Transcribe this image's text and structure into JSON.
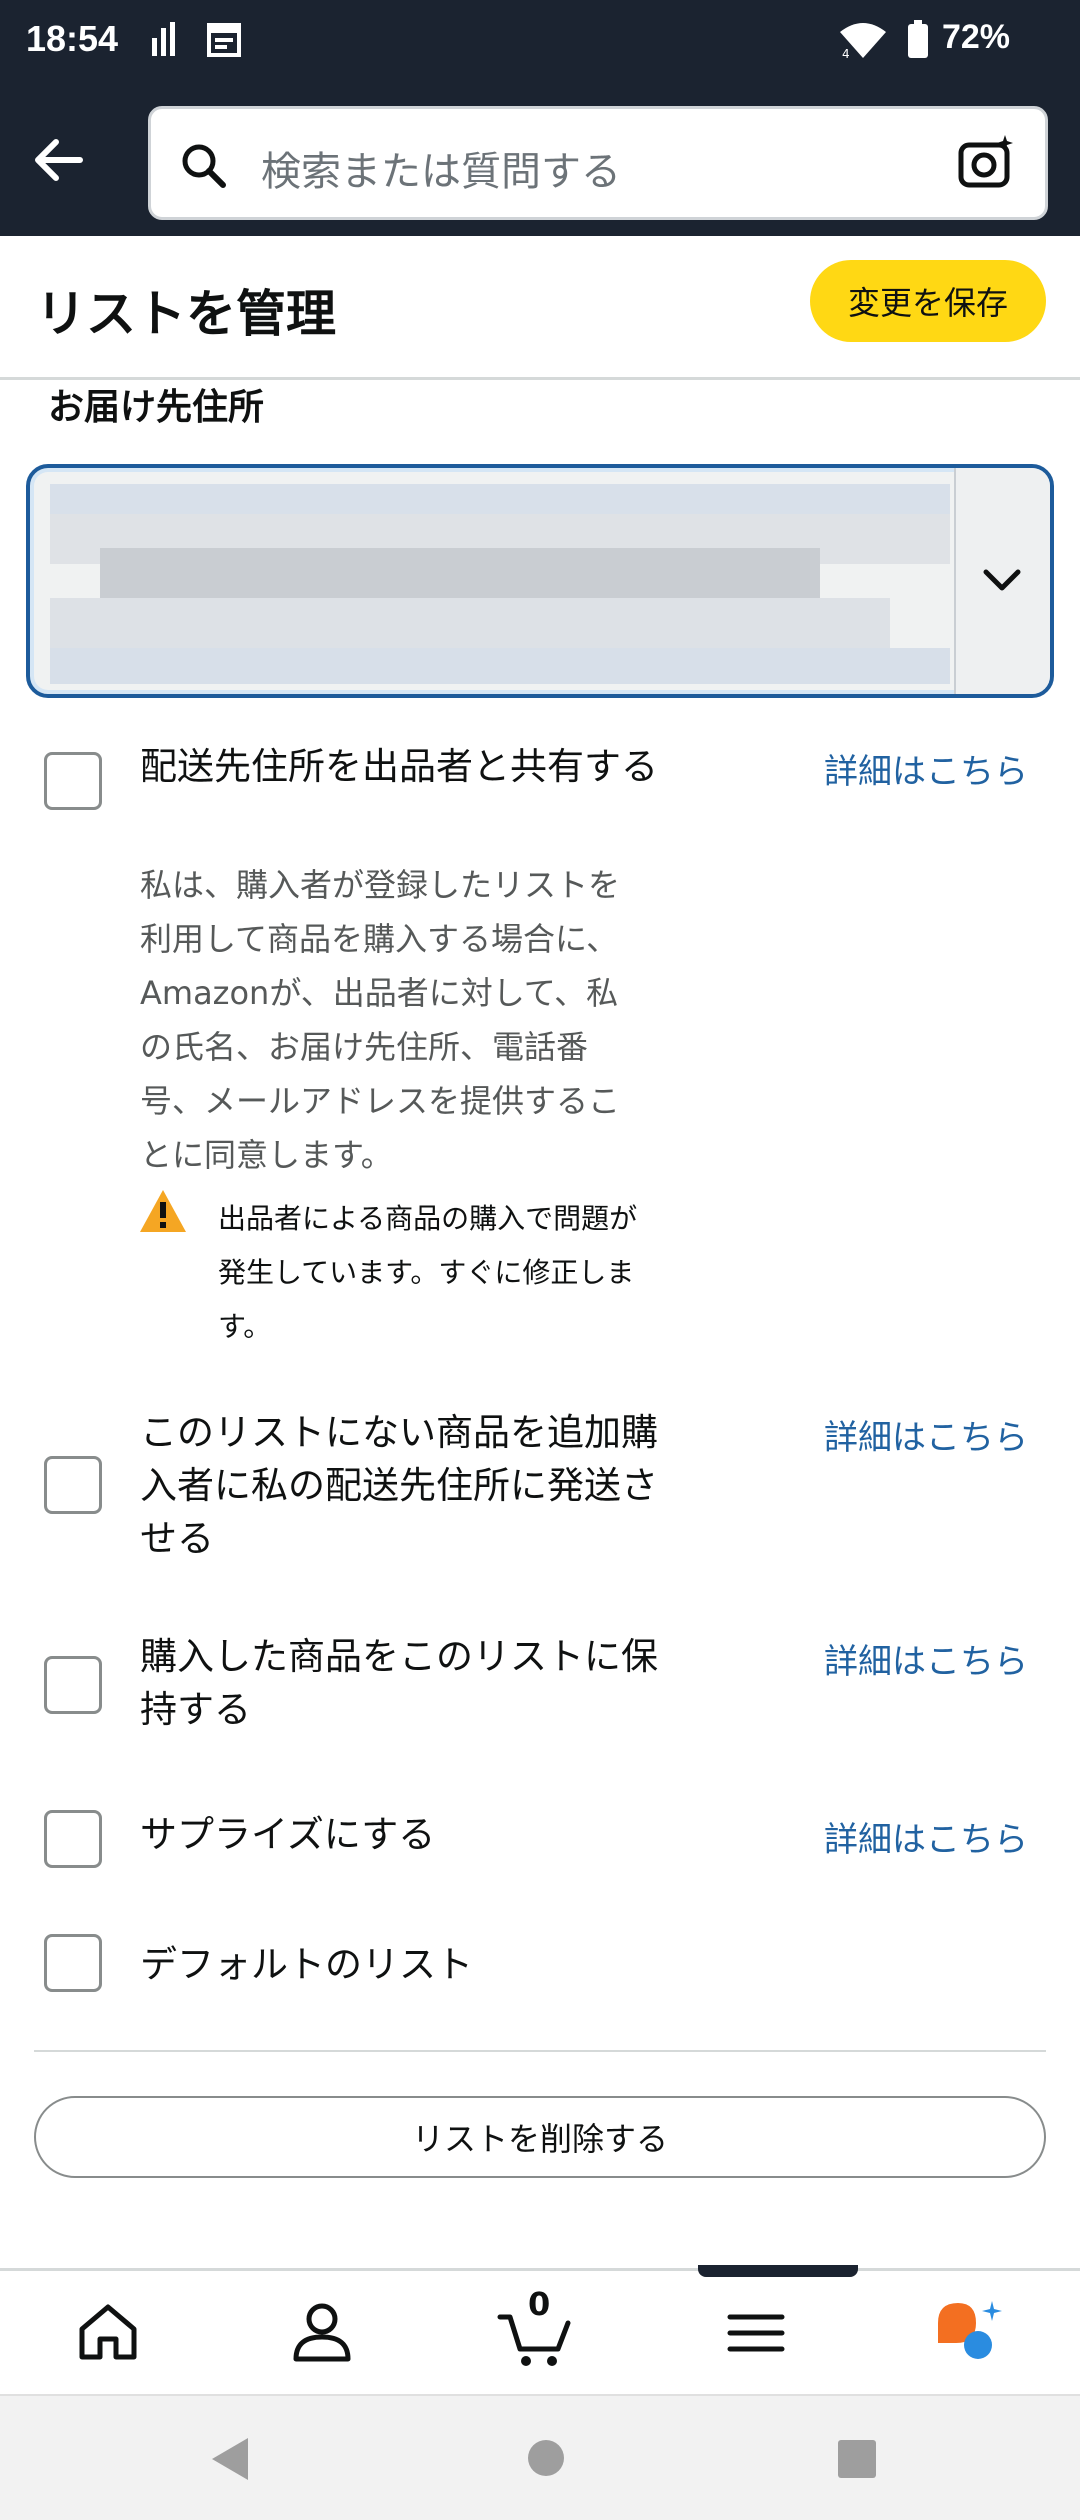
{
  "status_bar": {
    "time": "18:54",
    "battery": "72%",
    "icons": [
      "signal-bars-icon",
      "calendar-icon",
      "wifi-icon",
      "battery-icon"
    ]
  },
  "header": {
    "search_placeholder": "検索または質問する",
    "icons": [
      "back-arrow-icon",
      "search-icon",
      "camera-icon"
    ]
  },
  "title_bar": {
    "title": "リストを管理",
    "save_label": "変更を保存",
    "save_color": "#ffd814"
  },
  "address": {
    "section_label": "お届け先住所"
  },
  "options": [
    {
      "label": "配送先住所を出品者と共有する",
      "checked": false,
      "link": "詳細はこちら"
    },
    {
      "label": "このリストにない商品を追加購入者に私の配送先住所に発送させる",
      "checked": false,
      "link": "詳細はこちら"
    },
    {
      "label": "購入した商品をこのリストに保持する",
      "checked": false,
      "link": "詳細はこちら"
    },
    {
      "label": "サプライズにする",
      "checked": false,
      "link": "詳細はこちら"
    },
    {
      "label": "デフォルトのリスト",
      "checked": false
    }
  ],
  "share_description": "私は、購入者が登録したリストを利用して商品を購入する場合に、Amazonが、出品者に対して、私の氏名、お届け先住所、電話番号、メールアドレスを提供することに同意します。",
  "warning": "出品者による商品の購入で問題が発生しています。すぐに修正します。",
  "delete_label": "リストを削除する",
  "bottom_nav": {
    "cart_count": "0",
    "items": [
      "home-icon",
      "account-icon",
      "cart-icon",
      "menu-icon",
      "rufus-icon"
    ]
  },
  "colors": {
    "header_bg": "#1b2330",
    "link": "#2162a1",
    "focus_border": "#1d5b9b",
    "warning": "#f5a623"
  }
}
